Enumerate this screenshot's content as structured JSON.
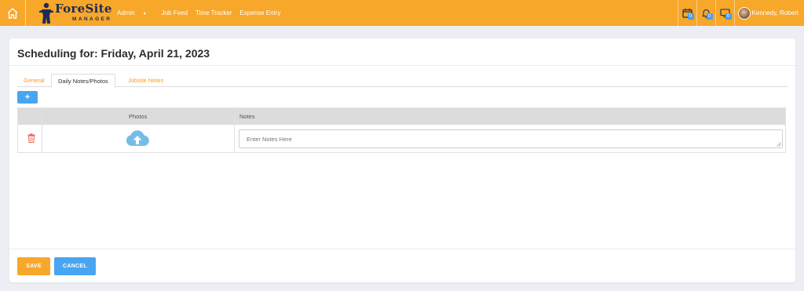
{
  "navbar": {
    "logo_text": "ForeSite",
    "logo_sub": "MANAGER",
    "links": [
      "Admin",
      "Job Feed",
      "Time Tracker",
      "Expense Entry"
    ],
    "badges": {
      "calendar": "0",
      "bell": "0",
      "monitor": "0"
    },
    "user_name": "Kennedy, Robert",
    "colors": {
      "bar": "#f7a72a",
      "badge": "#4a9fe8",
      "logo": "#1d2a57"
    }
  },
  "page": {
    "title": "Scheduling for: Friday, April 21, 2023",
    "tabs": [
      {
        "label": "General",
        "active": false
      },
      {
        "label": "Daily Notes/Photos",
        "active": true
      },
      {
        "label": "Jobsite Notes",
        "active": false
      }
    ],
    "add_label": "+",
    "table": {
      "headers": [
        "Photos",
        "Notes"
      ],
      "rows": [
        {
          "notes_placeholder": "Enter Notes Here",
          "notes_value": ""
        }
      ]
    },
    "buttons": {
      "save": "SAVE",
      "cancel": "CANCEL"
    },
    "colors": {
      "primary": "#4aa5f0",
      "accent": "#f7a72a",
      "delete": "#e8625a"
    }
  }
}
